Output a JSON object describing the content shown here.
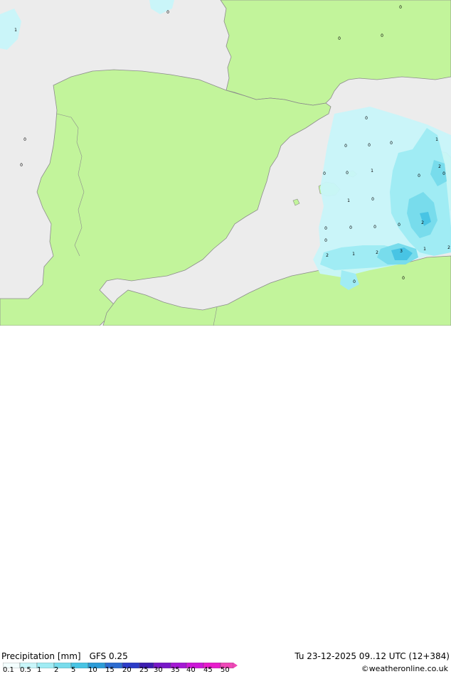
{
  "title": {
    "product": "Precipitation [mm]",
    "model": "GFS 0.25"
  },
  "valid_time": "Tu 23-12-2025 09..12 UTC (12+384)",
  "credit": "©weatheronline.co.uk",
  "colors": {
    "sea": "#ececec",
    "land": "#c2f49b",
    "coast": "#8c8c8c",
    "border": "#8c8c8c"
  },
  "legend": {
    "ticks": [
      "0.1",
      "0.5",
      "1",
      "2",
      "5",
      "10",
      "15",
      "20",
      "25",
      "30",
      "35",
      "40",
      "45",
      "50"
    ],
    "colors": [
      "#f3fefe",
      "#c8f6fa",
      "#a0ecf4",
      "#78dcec",
      "#48c4e4",
      "#2c9cd8",
      "#2c6cd0",
      "#2c3cc8",
      "#3c1cb0",
      "#7818c8",
      "#a418d4",
      "#cc18d8",
      "#e81ccc",
      "#f048b8"
    ]
  },
  "station_values": [
    {
      "label": "1"
    },
    {
      "label": "0"
    },
    {
      "label": "0"
    },
    {
      "label": "0"
    },
    {
      "label": "0"
    },
    {
      "label": "0"
    },
    {
      "label": "0"
    },
    {
      "label": "0"
    },
    {
      "label": "0"
    },
    {
      "label": "0"
    },
    {
      "label": "1"
    },
    {
      "label": "0"
    },
    {
      "label": "2"
    },
    {
      "label": "0"
    },
    {
      "label": "0"
    },
    {
      "label": "1"
    },
    {
      "label": "0"
    },
    {
      "label": "0"
    },
    {
      "label": "1"
    },
    {
      "label": "0"
    },
    {
      "label": "0"
    },
    {
      "label": "0"
    },
    {
      "label": "0"
    },
    {
      "label": "0"
    },
    {
      "label": "2"
    },
    {
      "label": "2"
    },
    {
      "label": "1"
    },
    {
      "label": "2"
    },
    {
      "label": "3"
    },
    {
      "label": "1"
    },
    {
      "label": "2"
    },
    {
      "label": "0"
    },
    {
      "label": "0"
    },
    {
      "label": "0"
    }
  ]
}
